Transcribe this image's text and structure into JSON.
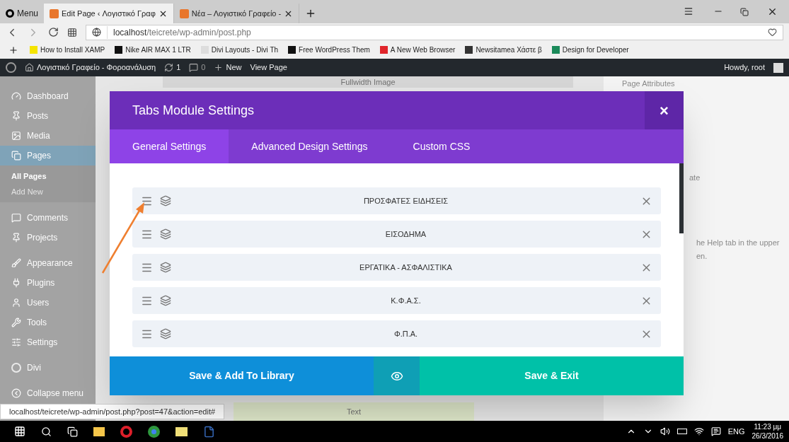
{
  "browser": {
    "menu_label": "Menu",
    "tabs": [
      {
        "title": "Edit Page ‹ Λογιστικό Γραφ",
        "selected": true
      },
      {
        "title": "Νέα – Λογιστικό Γραφείο -",
        "selected": false
      }
    ],
    "url_host": "localhost",
    "url_path": "/teicrete/wp-admin/post.php",
    "bookmarks": [
      {
        "title": "How to Install XAMP",
        "color": "#f5e400"
      },
      {
        "title": "Nike AIR MAX 1 LTR",
        "color": "#111111"
      },
      {
        "title": "Divi Layouts - Divi Th",
        "color": "#dddddd"
      },
      {
        "title": "Free WordPress Them",
        "color": "#111111"
      },
      {
        "title": "A New Web Browser",
        "color": "#e0252b"
      },
      {
        "title": "Newsitamea Χάστε β",
        "color": "#333333"
      },
      {
        "title": "Design for Developer",
        "color": "#1b8a5a"
      }
    ]
  },
  "admin_bar": {
    "site": "Λογιστικό Γραφείο - Φοροανάλυση",
    "updates": "1",
    "comments": "0",
    "new": "New",
    "view": "View Page",
    "greeting": "Howdy, root"
  },
  "sidebar": {
    "items": [
      {
        "label": "Dashboard",
        "selected": false
      },
      {
        "label": "Posts",
        "selected": false
      },
      {
        "label": "Media",
        "selected": false
      },
      {
        "label": "Pages",
        "selected": true,
        "children": [
          {
            "label": "All Pages",
            "selected": true
          },
          {
            "label": "Add New",
            "selected": false
          }
        ]
      },
      {
        "label": "Comments",
        "selected": false
      },
      {
        "label": "Projects",
        "selected": false
      },
      {
        "label": "Appearance",
        "selected": false
      },
      {
        "label": "Plugins",
        "selected": false
      },
      {
        "label": "Users",
        "selected": false
      },
      {
        "label": "Tools",
        "selected": false
      },
      {
        "label": "Settings",
        "selected": false
      },
      {
        "label": "Divi",
        "selected": false
      },
      {
        "label": "Collapse menu",
        "selected": false
      }
    ]
  },
  "background": {
    "module_top": "Fullwidth Image",
    "module_bottom": "Text",
    "panel_title": "Page Attributes",
    "select_fragment": "ate",
    "help_line_1": "he Help tab in the upper",
    "help_line_2": "en."
  },
  "modal": {
    "title": "Tabs Module Settings",
    "close": "×",
    "tabs": [
      {
        "label": "General Settings",
        "selected": true
      },
      {
        "label": "Advanced Design Settings",
        "selected": false
      },
      {
        "label": "Custom CSS",
        "selected": false
      }
    ],
    "rows": [
      "ΠΡΟΣΦΑΤΕΣ ΕΙΔΗΣΕΙΣ",
      "ΕΙΣΟΔΗΜΑ",
      "ΕΡΓΑΤΙΚΑ - ΑΣΦΑΛΙΣΤΙΚΑ",
      "Κ.Φ.Α.Σ.",
      "Φ.Π.Α."
    ],
    "save_library": "Save & Add To Library",
    "save_exit": "Save & Exit"
  },
  "status_url": "localhost/teicrete/wp-admin/post.php?post=47&action=edit#",
  "taskbar": {
    "language": "ENG",
    "time": "11:23 μμ",
    "date": "26/3/2016"
  }
}
